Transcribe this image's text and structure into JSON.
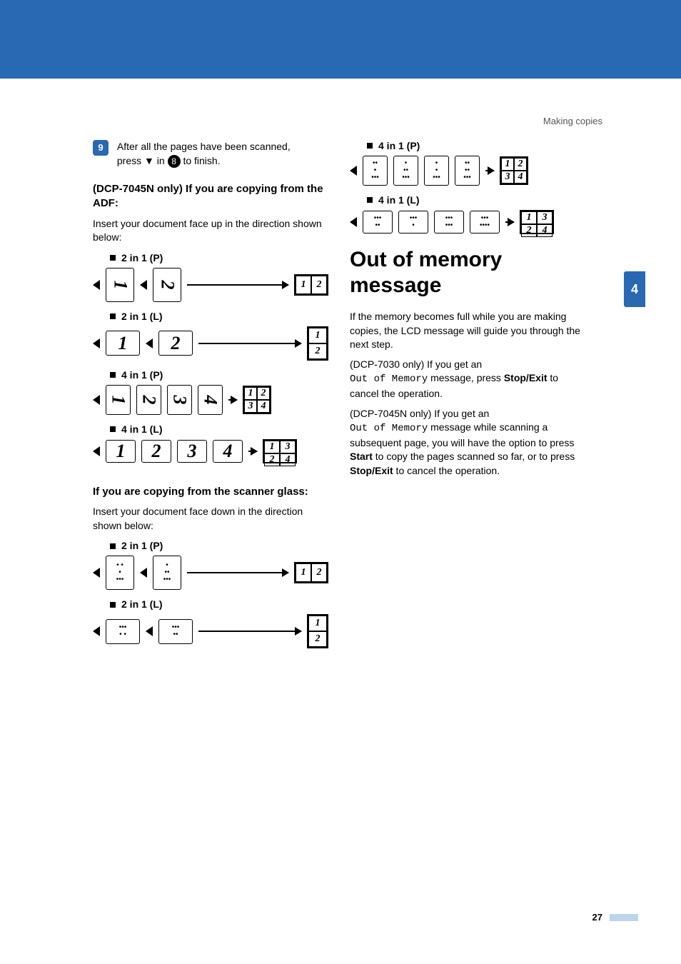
{
  "header_right": "Making copies",
  "side_tab": "4",
  "left": {
    "step_badge": "9",
    "step_text_before": "After all the pages have been scanned, press ",
    "step_key1": "▼",
    "step_text_mid": " in ",
    "step_ref": "8",
    "step_text_after": " to finish.",
    "sub_adf": "(DCP-7045N only) If you are copying from the ADF:",
    "adf_intro": "Insert your document face up in the direction shown below:",
    "labels": {
      "p2in1p": "2 in 1 (P)",
      "p2in1l": "2 in 1 (L)",
      "p4in1p": "4 in 1 (P)",
      "p4in1l": "4 in 1 (L)"
    },
    "sub_glass": "If you are copying from the scanner glass:",
    "glass_intro": "Insert your document face down in the direction shown below:"
  },
  "right": {
    "labels": {
      "p4in1p": "4 in 1 (P)",
      "p4in1l": "4 in 1 (L)"
    },
    "heading": "Out of memory message",
    "para1": "If the memory becomes full while you are making copies, the LCD message will guide you through the next step.",
    "para2_pre": "(DCP-7030 only) If you get an ",
    "para2_mono": "Out of Memory",
    "para2_mid": " message, press ",
    "para2_btn": "Stop/Exit",
    "para2_post": " to cancel the operation.",
    "para3_pre": "(DCP-7045N only) If you get an ",
    "para3_mono": "Out of Memory",
    "para3_mid": " message while scanning a subsequent page, you will have the option to press ",
    "para3_btn1": "Start",
    "para3_mid2": " to copy the pages scanned so far, or to press ",
    "para3_btn2": "Stop/Exit",
    "para3_post": " to cancel the operation."
  },
  "page_number": "27",
  "nums": {
    "n1": "1",
    "n2": "2",
    "n3": "3",
    "n4": "4"
  }
}
